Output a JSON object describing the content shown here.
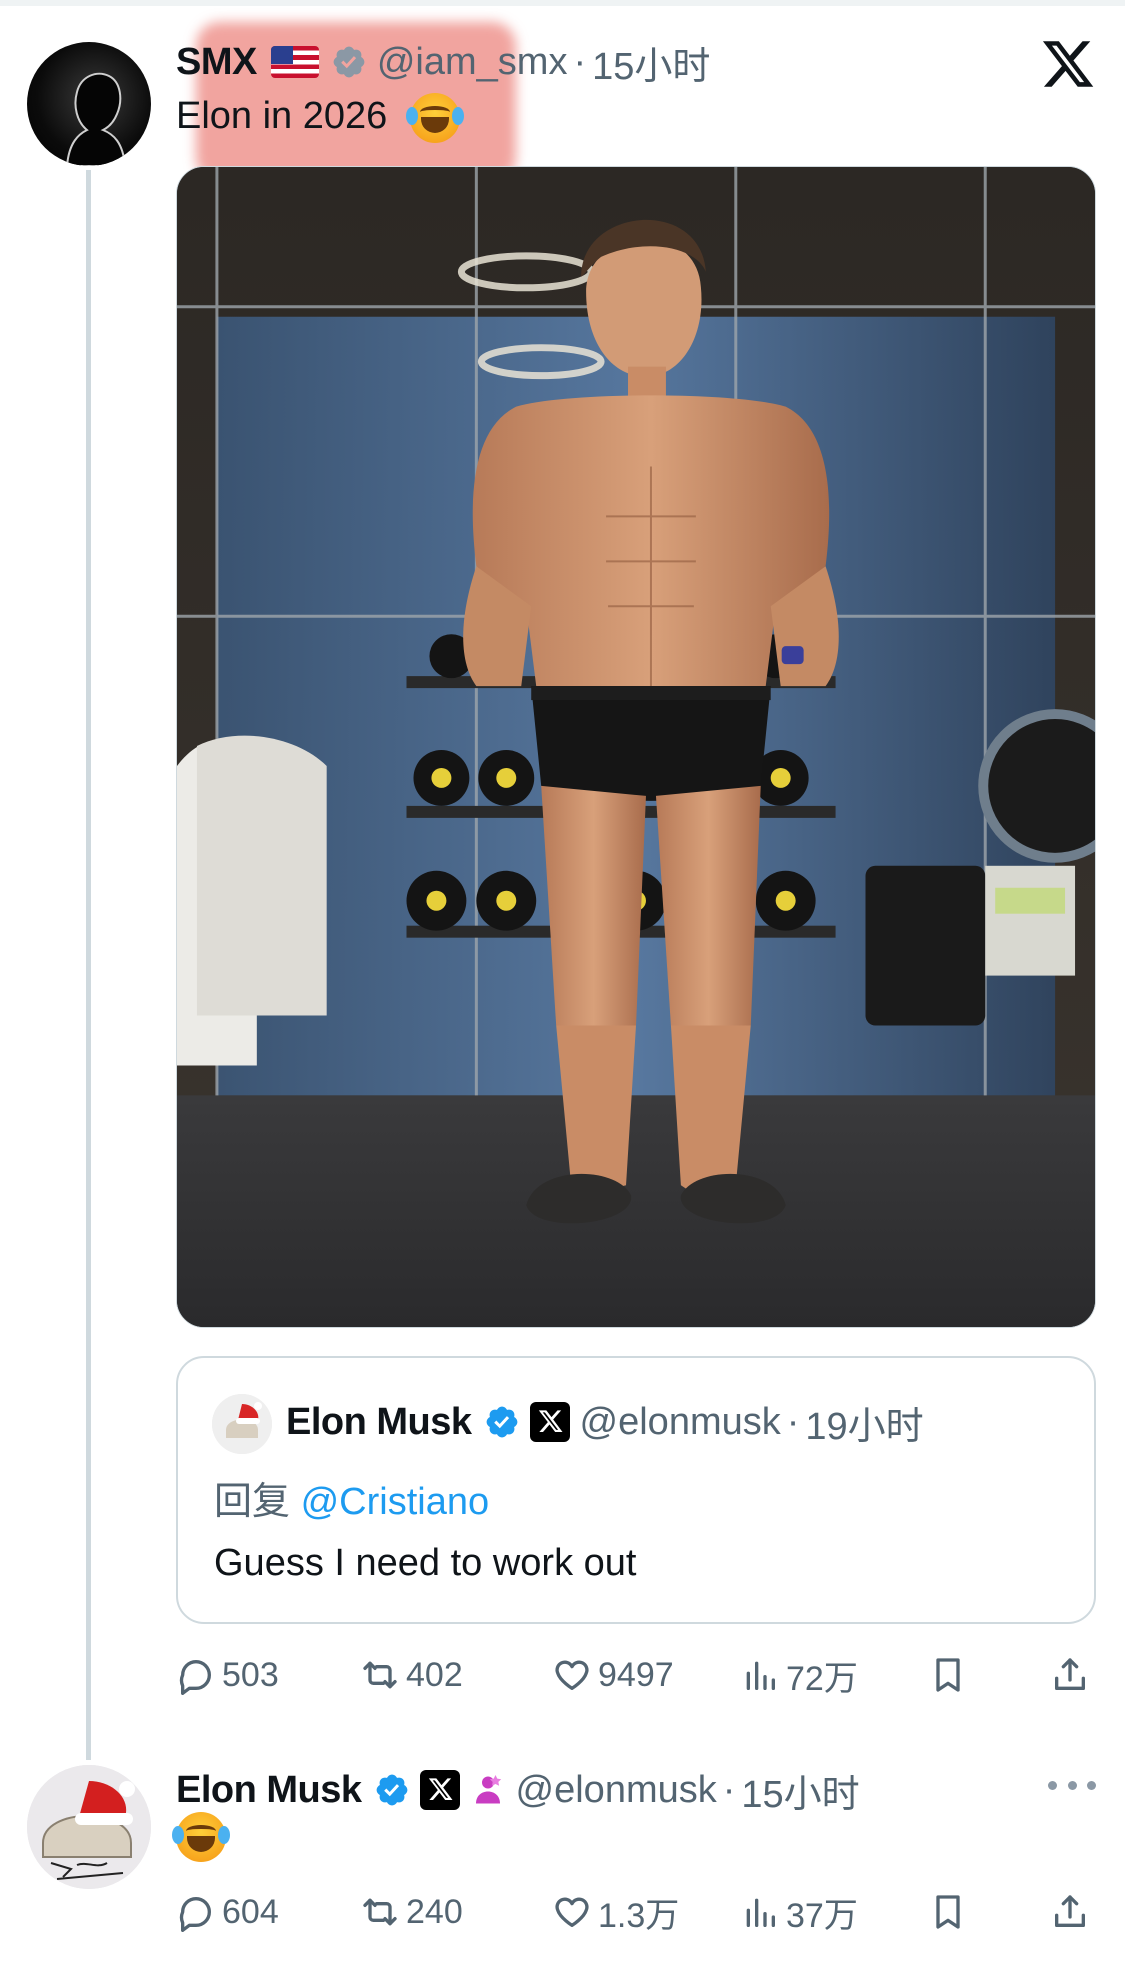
{
  "main_tweet": {
    "author_name": "SMX",
    "handle": "@iam_smx",
    "separator": "·",
    "time": "15小时",
    "text": "Elon in 2026",
    "icons": [
      "flag-us-icon",
      "verified-gray-icon",
      "x-logo-icon"
    ],
    "stats": {
      "replies": "503",
      "retweets": "402",
      "likes": "9497",
      "views": "72万"
    }
  },
  "quoted_tweet": {
    "author_name": "Elon Musk",
    "handle": "@elonmusk",
    "separator": "·",
    "time": "19小时",
    "reply_prefix": "回复",
    "reply_mention": "@Cristiano",
    "text": "Guess I need to work out"
  },
  "reply_tweet": {
    "author_name": "Elon Musk",
    "handle": "@elonmusk",
    "separator": "·",
    "time": "15小时",
    "stats": {
      "replies": "604",
      "retweets": "240",
      "likes": "1.3万",
      "views": "37万"
    }
  },
  "colors": {
    "verified_blue": "#1d9bf0",
    "verified_gray": "#8b98a5",
    "muted_text": "#536471",
    "mention": "#1d9bf0",
    "highlight": "#e65a50"
  }
}
